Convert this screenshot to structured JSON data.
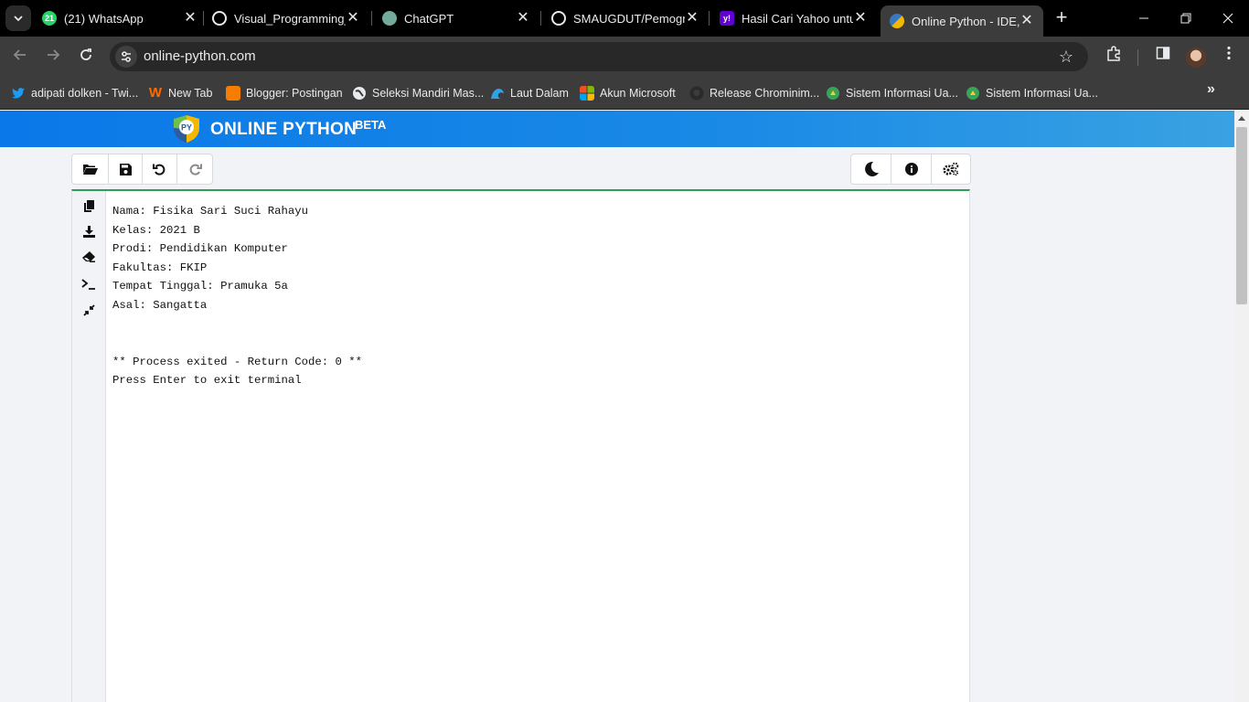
{
  "browser": {
    "tabs": [
      {
        "title": "(21) WhatsApp",
        "favicon": "whatsapp-icon",
        "color": "#25d366"
      },
      {
        "title": "Visual_Programming_",
        "favicon": "github-icon",
        "color": "#e8eaed"
      },
      {
        "title": "ChatGPT",
        "favicon": "chatgpt-icon",
        "color": "#74aa9c"
      },
      {
        "title": "SMAUGDUT/Pemogra",
        "favicon": "github-icon",
        "color": "#e8eaed"
      },
      {
        "title": "Hasil Cari Yahoo untu",
        "favicon": "yahoo-icon",
        "color": "#6001d2"
      },
      {
        "title": "Online Python - IDE, E",
        "favicon": "online-python-icon",
        "color": "#f5b800",
        "active": true
      }
    ],
    "whatsapp_badge": "21",
    "url": "online-python.com",
    "bookmarks": [
      {
        "label": "adipati dolken - Twi...",
        "icon": "twitter-icon",
        "color": "#1d9bf0"
      },
      {
        "label": "New Tab",
        "icon": "w-icon",
        "color": "#ff6b00"
      },
      {
        "label": "Blogger: Postingan",
        "icon": "blogger-icon",
        "color": "#f57d00"
      },
      {
        "label": "Seleksi Mandiri Mas...",
        "icon": "globe-icon",
        "color": "#e8eaed"
      },
      {
        "label": "Laut Dalam",
        "icon": "wave-icon",
        "color": "#2fa3e6"
      },
      {
        "label": "Akun Microsoft",
        "icon": "microsoft-icon",
        "color": "#f25022"
      },
      {
        "label": "Release Chrominim...",
        "icon": "github-icon",
        "color": "#2a2a2a"
      },
      {
        "label": "Sistem Informasi Ua...",
        "icon": "university-icon",
        "color": "#3aa35a"
      },
      {
        "label": "Sistem Informasi Ua...",
        "icon": "university-icon",
        "color": "#3aa35a"
      }
    ]
  },
  "site": {
    "logo_text": "ONLINE PYTHON",
    "logo_badge": "PY",
    "beta": "BETA",
    "header_color": "#0a78e8"
  },
  "terminal": {
    "lines": [
      "Nama: Fisika Sari Suci Rahayu",
      "Kelas: 2021 B",
      "Prodi: Pendidikan Komputer",
      "Fakultas: FKIP",
      "Tempat Tinggal: Pramuka 5a",
      "Asal: Sangatta",
      "",
      "",
      "** Process exited - Return Code: 0 **",
      "Press Enter to exit terminal"
    ]
  }
}
